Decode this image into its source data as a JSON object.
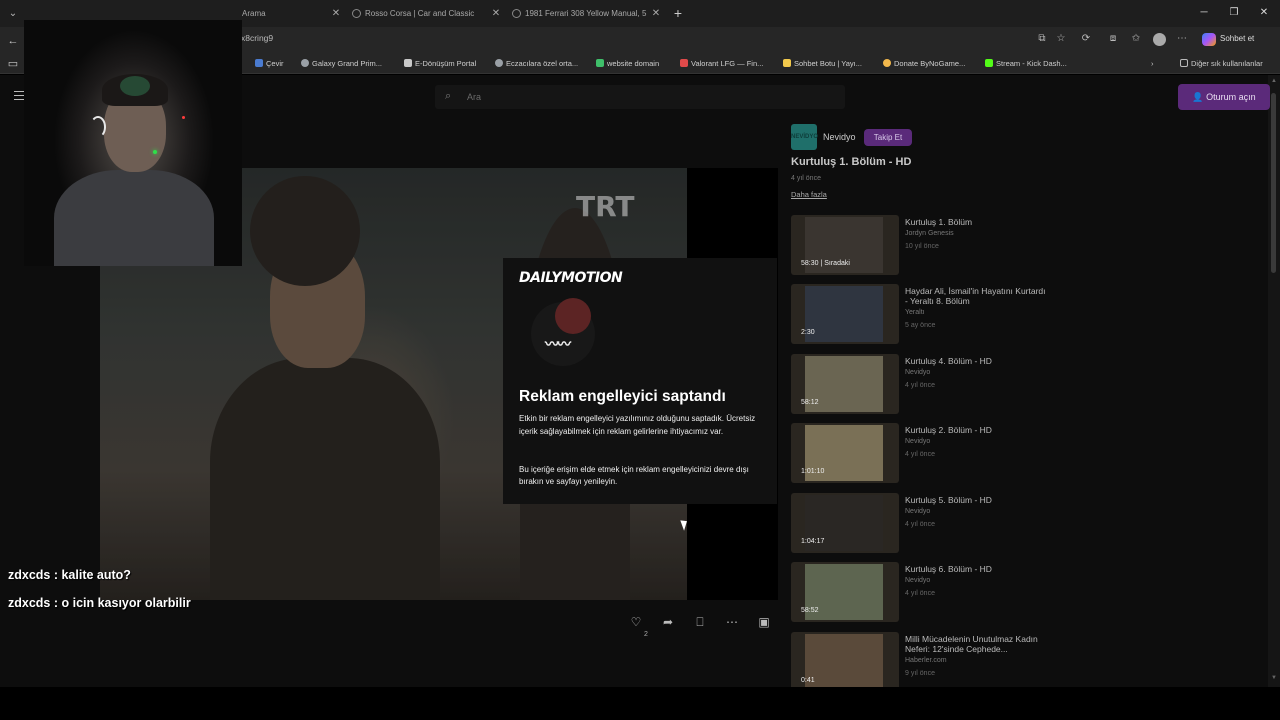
{
  "browser": {
    "tabs": [
      {
        "label": "Arama"
      },
      {
        "label": "Rosso Corsa | Car and Classic"
      },
      {
        "label": "1981 Ferrari 308 Yellow Manual, 5"
      }
    ],
    "url": "x8cring9",
    "chat_label": "Sohbet et",
    "bookmarks": [
      {
        "label": "Çevir",
        "color": "#4a7bd0"
      },
      {
        "label": "Galaxy Grand Prim...",
        "color": "#9aa0a6"
      },
      {
        "label": "E-Dönüşüm Portal",
        "color": "#c9c9c9"
      },
      {
        "label": "Eczacılara özel orta...",
        "color": "#9aa0a6"
      },
      {
        "label": "website domain",
        "color": "#3fbf6a"
      },
      {
        "label": "Valorant LFG — Fin...",
        "color": "#e04a4a"
      },
      {
        "label": "Sohbet Botu | Yayı...",
        "color": "#f2c94c"
      },
      {
        "label": "Donate ByNoGame...",
        "color": "#f2b84c"
      },
      {
        "label": "Stream - Kick Dash...",
        "color": "#53fc18"
      }
    ],
    "other_bookmarks": "Diğer sık kullanılanlar"
  },
  "site": {
    "search_placeholder": "Ara",
    "login_label": "Oturum açın"
  },
  "player": {
    "watermark": "TRT",
    "adblock": {
      "brand": "DAILYMOTION",
      "title": "Reklam engelleyici saptandı",
      "p1": "Etkin bir reklam engelleyici yazılımınız olduğunu saptadık. Ücretsiz içerik sağlayabilmek için reklam gelirlerine ihtiyacımız var.",
      "p2": "Bu içeriğe erişim elde etmek için reklam engelleyicinizi devre dışı bırakın ve sayfayı yenileyin."
    },
    "like_count": "2"
  },
  "video": {
    "channel": "Nevidyo",
    "channel_avatar_text": "NEVİDYO",
    "follow_label": "Takip Et",
    "title": "Kurtuluş 1. Bölüm - HD",
    "age": "4 yıl önce",
    "more_label": "Daha fazla"
  },
  "recommendations": [
    {
      "title": "Kurtuluş 1. Bölüm",
      "channel": "Jordyn Genesis",
      "age": "10 yıl önce",
      "duration": "58:30 | Sıradaki",
      "tint": "#3a3530"
    },
    {
      "title": "Haydar Ali, İsmail'in Hayatını Kurtardı - Yeraltı 8. Bölüm",
      "channel": "Yeraltı",
      "age": "5 ay önce",
      "duration": "2:30",
      "tint": "#2f3540"
    },
    {
      "title": "Kurtuluş 4. Bölüm - HD",
      "channel": "Nevidyo",
      "age": "4 yıl önce",
      "duration": "58:12",
      "tint": "#6a6552"
    },
    {
      "title": "Kurtuluş 2. Bölüm - HD",
      "channel": "Nevidyo",
      "age": "4 yıl önce",
      "duration": "1:01:10",
      "tint": "#7a7056"
    },
    {
      "title": "Kurtuluş 5. Bölüm - HD",
      "channel": "Nevidyo",
      "age": "4 yıl önce",
      "duration": "1:04:17",
      "tint": "#2a2724"
    },
    {
      "title": "Kurtuluş 6. Bölüm - HD",
      "channel": "Nevidyo",
      "age": "4 yıl önce",
      "duration": "58:52",
      "tint": "#5d6550"
    },
    {
      "title": "Milli Mücadelenin Unutulmaz Kadın Neferi: 12'sinde Cephede...",
      "channel": "Haberler.com",
      "age": "9 yıl önce",
      "duration": "0:41",
      "tint": "#5a4a3a"
    }
  ],
  "chat": [
    {
      "text": "zdxcds : kalite auto?"
    },
    {
      "text": "zdxcds : o icin kasıyor olarbilir"
    }
  ]
}
